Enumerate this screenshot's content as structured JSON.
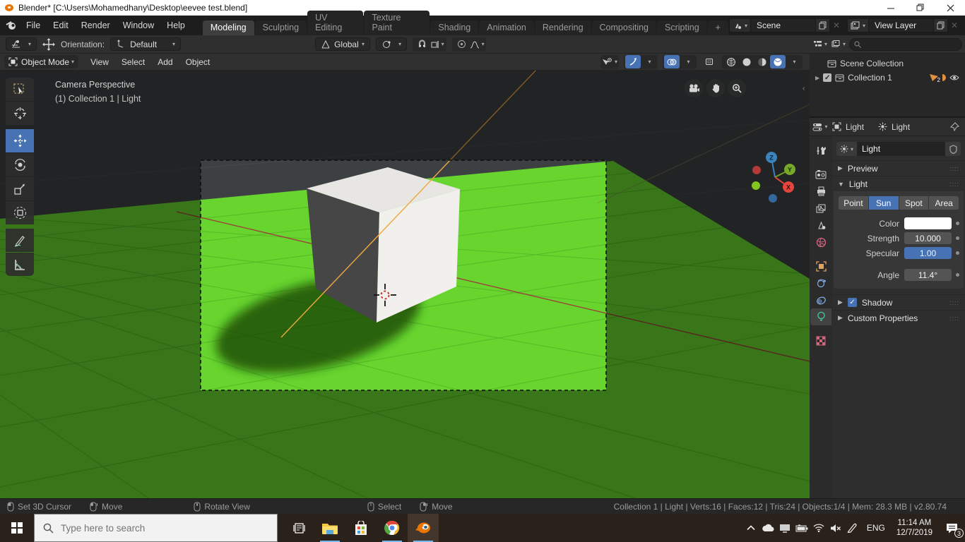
{
  "titlebar": {
    "title": "Blender* [C:\\Users\\Mohamedhany\\Desktop\\eevee test.blend]"
  },
  "topbar": {
    "menus": [
      "File",
      "Edit",
      "Render",
      "Window",
      "Help"
    ],
    "tabs": [
      "Modeling",
      "Sculpting",
      "UV Editing",
      "Texture Paint",
      "Shading",
      "Animation",
      "Rendering",
      "Compositing",
      "Scripting",
      "+"
    ],
    "active_tab": "Modeling",
    "scene_label": "Scene",
    "view_layer_label": "View Layer"
  },
  "tool_settings": {
    "orientation_label": "Orientation:",
    "orientation_value": "Default",
    "transform_orientation": "Global"
  },
  "viewport_header": {
    "mode": "Object Mode",
    "menus": [
      "View",
      "Select",
      "Add",
      "Object"
    ]
  },
  "viewport": {
    "overlay_line1": "Camera Perspective",
    "overlay_line2": "(1) Collection 1 | Light",
    "axis_x": "X",
    "axis_y": "Y",
    "axis_z": "Z"
  },
  "outliner": {
    "scene_collection": "Scene Collection",
    "collection": "Collection 1",
    "mesh_count": "2"
  },
  "properties": {
    "breadcrumb_object": "Light",
    "breadcrumb_data": "Light",
    "name_value": "Light",
    "panel_preview": "Preview",
    "panel_light": "Light",
    "panel_shadow": "Shadow",
    "panel_custom": "Custom Properties",
    "light_types": [
      "Point",
      "Sun",
      "Spot",
      "Area"
    ],
    "active_type": "Sun",
    "color_label": "Color",
    "strength_label": "Strength",
    "strength_value": "10.000",
    "specular_label": "Specular",
    "specular_value": "1.00",
    "angle_label": "Angle",
    "angle_value": "11.4°"
  },
  "statusbar": {
    "hint1": "Set 3D Cursor",
    "hint2": "Move",
    "hint3": "Rotate View",
    "hint4": "Select",
    "hint5": "Move",
    "stats": "Collection 1 | Light | Verts:16 | Faces:12 | Tris:24 | Objects:1/4 | Mem: 28.3 MB | v2.80.74"
  },
  "taskbar": {
    "search_placeholder": "Type here to search",
    "language": "ENG",
    "time": "11:14 AM",
    "date": "12/7/2019",
    "notification_count": "3"
  },
  "colors": {
    "accent": "#4772b3",
    "green_bright": "#68d52e",
    "green_dim": "#3f6b21"
  }
}
